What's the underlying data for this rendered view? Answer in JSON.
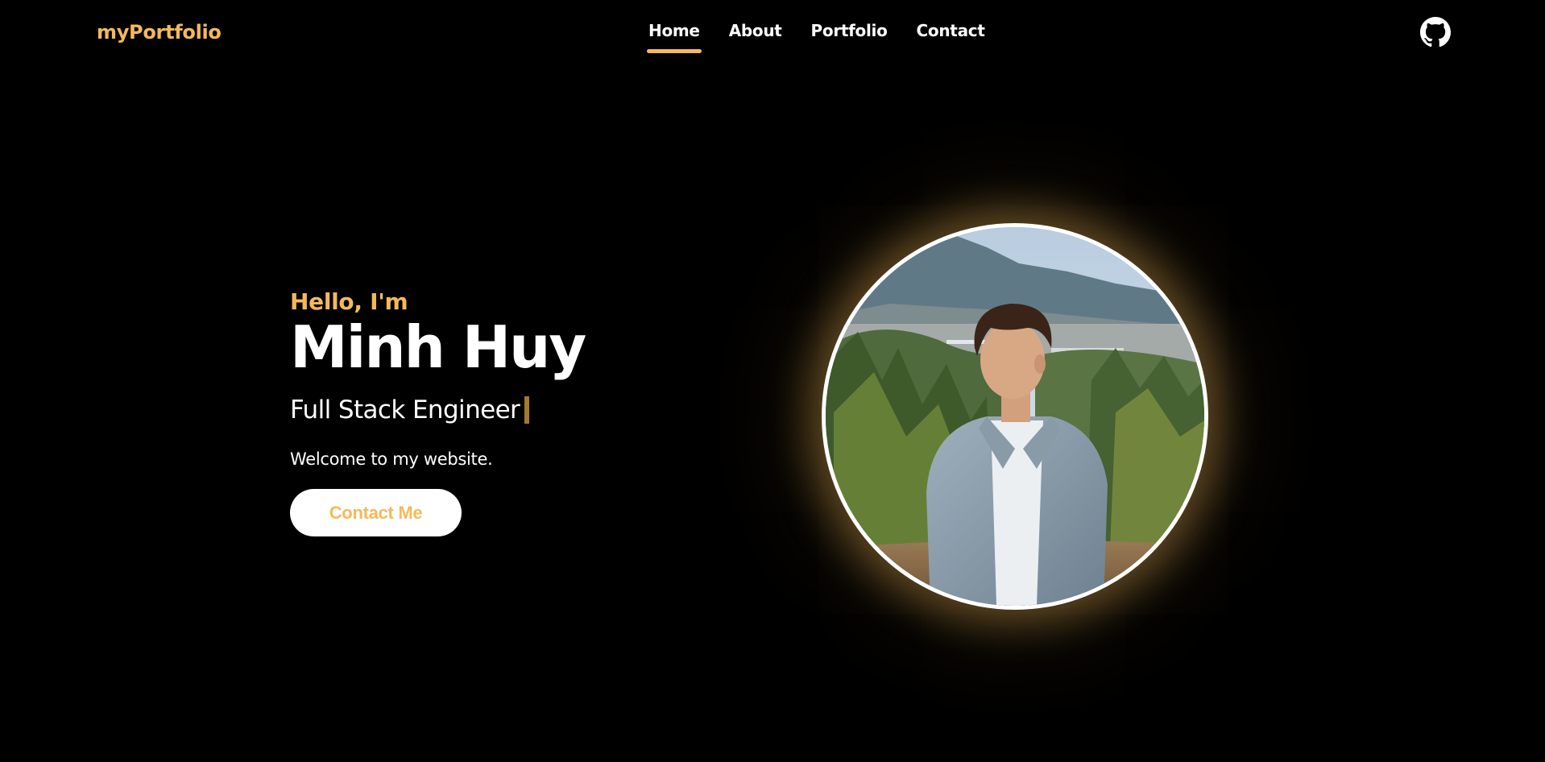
{
  "header": {
    "logo": "myPortfolio",
    "nav": [
      {
        "label": "Home",
        "active": true
      },
      {
        "label": "About",
        "active": false
      },
      {
        "label": "Portfolio",
        "active": false
      },
      {
        "label": "Contact",
        "active": false
      }
    ],
    "github_icon": "github-icon"
  },
  "hero": {
    "greeting": "Hello, I'm",
    "name": "Minh Huy",
    "role": "Full Stack Engineer",
    "welcome": "Welcome to my website.",
    "cta_label": "Contact Me"
  },
  "colors": {
    "accent": "#f5b95a",
    "background": "#000000",
    "text": "#ffffff"
  }
}
